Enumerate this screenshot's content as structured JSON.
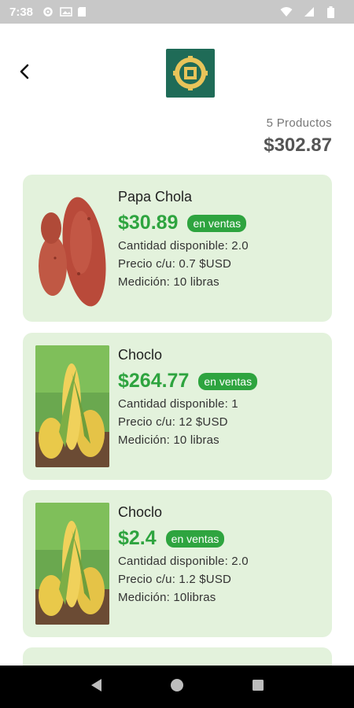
{
  "status_bar": {
    "time": "7:38"
  },
  "summary": {
    "count": "5 Productos",
    "total": "$302.87"
  },
  "products": [
    {
      "name": "Papa Chola",
      "price": "$30.89",
      "badge": "en ventas",
      "available": "Cantidad disponible: 2.0",
      "unit_price": "Precio c/u: 0.7 $USD",
      "measure": "Medición:  10 libras",
      "image": "potato"
    },
    {
      "name": "Choclo",
      "price": "$264.77",
      "badge": "en ventas",
      "available": "Cantidad disponible: 1",
      "unit_price": "Precio c/u: 12 $USD",
      "measure": "Medición: 10 libras",
      "image": "corn"
    },
    {
      "name": "Choclo",
      "price": "$2.4",
      "badge": "en ventas",
      "available": "Cantidad disponible: 2.0",
      "unit_price": "Precio c/u: 1.2 $USD",
      "measure": "Medición: 10libras",
      "image": "corn"
    }
  ],
  "colors": {
    "accent": "#2ea43f",
    "card_bg": "#e3f2dc",
    "logo_bg": "#1f6b57"
  }
}
